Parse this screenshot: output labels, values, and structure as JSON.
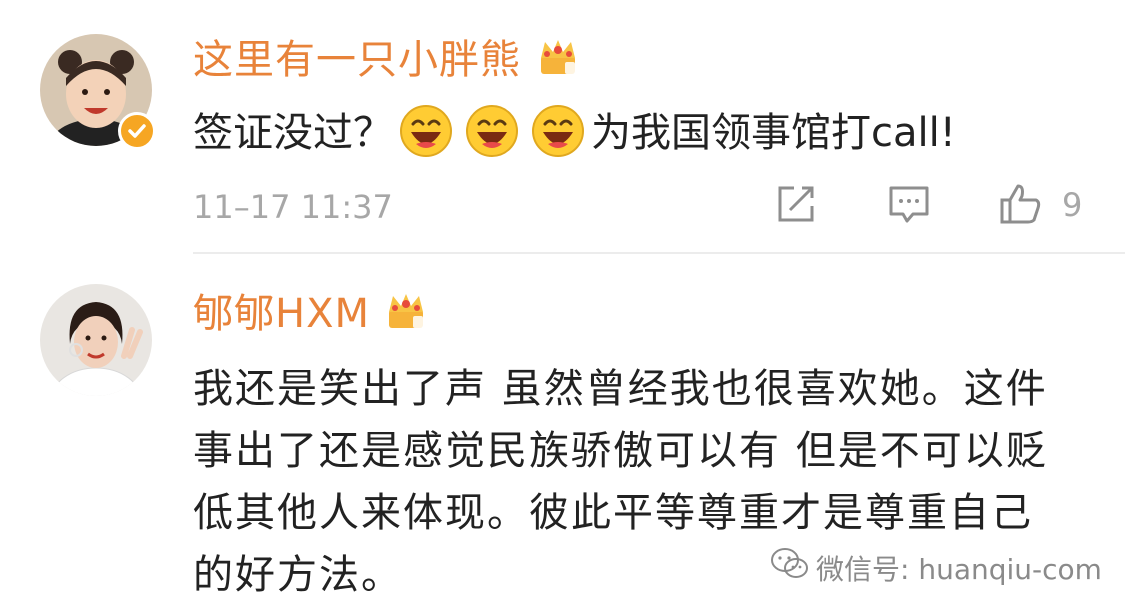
{
  "comments": [
    {
      "username": "这里有一只小胖熊",
      "text_before": "签证没过？",
      "text_after": "为我国领事馆打call!",
      "emoji_count": 3,
      "timestamp": "11–17 11:37",
      "likes": "9",
      "verified": true,
      "avatar_icon": "child-avatar",
      "badge_icon": "crown-icon"
    },
    {
      "username": "郇郇HXM",
      "text": "我还是笑出了声 虽然曾经我也很喜欢她。这件事出了还是感觉民族骄傲可以有 但是不可以贬低其他人来体现。彼此平等尊重才是尊重自己的好方法。",
      "avatar_icon": "woman-avatar",
      "badge_icon": "crown-icon"
    }
  ],
  "watermark": {
    "text": "微信号: huanqiu-com",
    "icon": "wechat-icon"
  },
  "colors": {
    "username": "#e8833a",
    "text": "#222222",
    "meta": "#a7a7a7",
    "badge": "#f6a623"
  }
}
